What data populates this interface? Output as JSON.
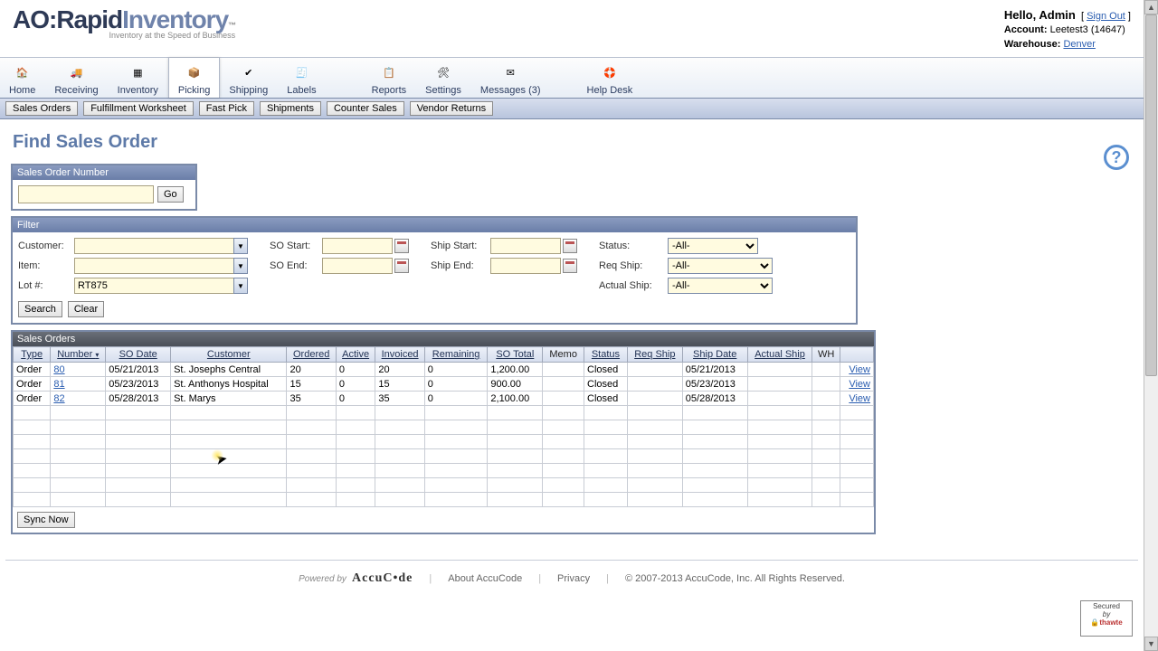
{
  "header": {
    "logo_prefix": "AO:",
    "logo_text1": "Rapid",
    "logo_text2": "Inventory",
    "logo_tagline": "Inventory at the Speed of Business",
    "hello_prefix": "Hello, ",
    "user": "Admin",
    "signout": "Sign Out",
    "account_label": "Account:",
    "account_value": "Leetest3 (14647)",
    "warehouse_label": "Warehouse:",
    "warehouse_value": "Denver"
  },
  "toolbar": {
    "items": [
      {
        "label": "Home"
      },
      {
        "label": "Receiving"
      },
      {
        "label": "Inventory"
      },
      {
        "label": "Picking"
      },
      {
        "label": "Shipping"
      },
      {
        "label": "Labels"
      },
      {
        "label": "Reports"
      },
      {
        "label": "Settings"
      },
      {
        "label": "Messages (3)"
      },
      {
        "label": "Help Desk"
      }
    ]
  },
  "subtabs": [
    "Sales Orders",
    "Fulfillment Worksheet",
    "Fast Pick",
    "Shipments",
    "Counter Sales",
    "Vendor Returns"
  ],
  "page_title": "Find Sales Order",
  "so_num": {
    "header": "Sales Order Number",
    "go": "Go"
  },
  "filter": {
    "header": "Filter",
    "customer_label": "Customer:",
    "item_label": "Item:",
    "lot_label": "Lot #:",
    "lot_value": "RT875",
    "so_start_label": "SO Start:",
    "so_end_label": "SO End:",
    "ship_start_label": "Ship Start:",
    "ship_end_label": "Ship End:",
    "status_label": "Status:",
    "reqship_label": "Req Ship:",
    "actualship_label": "Actual Ship:",
    "all_option": "-All-",
    "search": "Search",
    "clear": "Clear"
  },
  "results": {
    "header": "Sales Orders",
    "columns": [
      "Type",
      "Number",
      "SO Date",
      "Customer",
      "Ordered",
      "Active",
      "Invoiced",
      "Remaining",
      "SO Total",
      "Memo",
      "Status",
      "Req Ship",
      "Ship Date",
      "Actual Ship",
      "WH",
      ""
    ],
    "rows": [
      {
        "type": "Order",
        "number": "80",
        "so_date": "05/21/2013",
        "customer": "St. Josephs Central",
        "ordered": "20",
        "active": "0",
        "invoiced": "20",
        "remaining": "0",
        "so_total": "1,200.00",
        "memo": "",
        "status": "Closed",
        "req_ship": "",
        "ship_date": "05/21/2013",
        "actual_ship": "",
        "wh": "",
        "view": "View"
      },
      {
        "type": "Order",
        "number": "81",
        "so_date": "05/23/2013",
        "customer": "St. Anthonys Hospital",
        "ordered": "15",
        "active": "0",
        "invoiced": "15",
        "remaining": "0",
        "so_total": "900.00",
        "memo": "",
        "status": "Closed",
        "req_ship": "",
        "ship_date": "05/23/2013",
        "actual_ship": "",
        "wh": "",
        "view": "View"
      },
      {
        "type": "Order",
        "number": "82",
        "so_date": "05/28/2013",
        "customer": "St. Marys",
        "ordered": "35",
        "active": "0",
        "invoiced": "35",
        "remaining": "0",
        "so_total": "2,100.00",
        "memo": "",
        "status": "Closed",
        "req_ship": "",
        "ship_date": "05/28/2013",
        "actual_ship": "",
        "wh": "",
        "view": "View"
      }
    ],
    "sync": "Sync Now"
  },
  "footer": {
    "powered_by": "Powered by",
    "brand": "AccuC•de",
    "about": "About AccuCode",
    "privacy": "Privacy",
    "copyright": "© 2007-2013 AccuCode, Inc. All Rights Reserved.",
    "seal_l1": "Secured",
    "seal_l2": "by",
    "seal_l3": "thawte"
  },
  "help_tooltip": "?"
}
